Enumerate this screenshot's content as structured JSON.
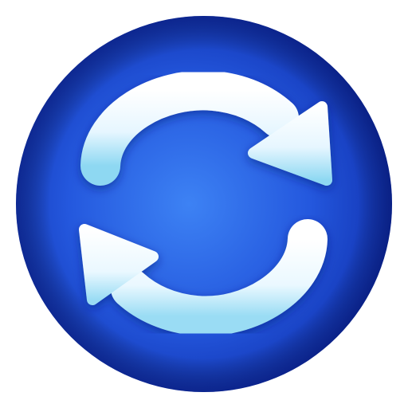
{
  "app_icon": {
    "icon": "sync-icon",
    "colors": {
      "background": "#ffffff",
      "disc_center": "#3b7cf0",
      "disc_mid": "#1f52d8",
      "disc_edge": "#0a2a9e",
      "arrow_light": "#f3fbff",
      "arrow_shadow": "#7fd3f0"
    }
  }
}
